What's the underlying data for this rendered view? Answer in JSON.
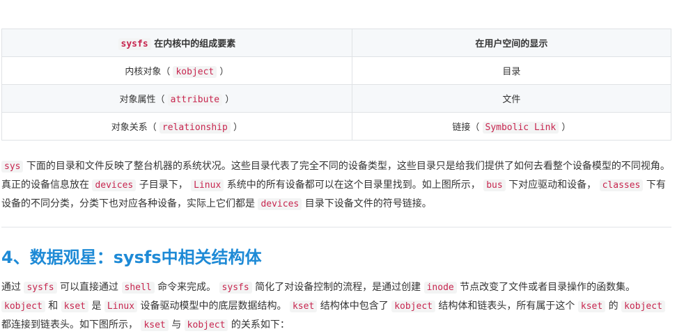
{
  "table": {
    "header": {
      "col1_code": "sysfs",
      "col1_text": " 在内核中的组成要素",
      "col2": "在用户空间的显示"
    },
    "rows": [
      {
        "pre": "内核对象（ ",
        "code": "kobject",
        "post": " ）",
        "value": "目录"
      },
      {
        "pre": "对象属性（ ",
        "code": "attribute",
        "post": " ）",
        "value": "文件"
      },
      {
        "pre": "对象关系（ ",
        "code": "relationship",
        "post": " ）",
        "value_pre": "链接（ ",
        "value_code": "Symbolic Link",
        "value_post": " ）"
      }
    ]
  },
  "para1": {
    "t1": "sys",
    "t2": " 下面的目录和文件反映了整台机器的系统状况。这些目录代表了完全不同的设备类型，这些目录只是给我们提供了如何去看整个设备模型的不同视角。真正的设备信息放在 ",
    "t3": "devices",
    "t4": " 子目录下， ",
    "t5": "Linux",
    "t6": " 系统中的所有设备都可以在这个目录里找到。如上图所示， ",
    "t7": "bus",
    "t8": " 下对应驱动和设备， ",
    "t9": "classes",
    "t10": " 下有设备的不同分类，分类下也对应各种设备，实际上它们都是 ",
    "t11": "devices",
    "t12": " 目录下设备文件的符号链接。"
  },
  "heading": "4、数据观星：sysfs中相关结构体",
  "para2": {
    "t1": "通过 ",
    "t2": "sysfs",
    "t3": " 可以直接通过 ",
    "t4": "shell",
    "t5": " 命令来完成。 ",
    "t6": "sysfs",
    "t7": " 简化了对设备控制的流程，是通过创建 ",
    "t8": "inode",
    "t9": " 节点改变了文件或者目录操作的函数集。 ",
    "t10": "kobject",
    "t11": " 和 ",
    "t12": "kset",
    "t13": " 是 ",
    "t14": "Linux",
    "t15": " 设备驱动模型中的底层数据结构。 ",
    "t16": "kset",
    "t17": " 结构体中包含了 ",
    "t18": "kobject",
    "t19": " 结构体和链表头，所有属于这个 ",
    "t20": "kset",
    "t21": " 的 ",
    "t22": "kobject",
    "t23": " 都连接到链表头。如下图所示， ",
    "t24": "kset",
    "t25": " 与 ",
    "t26": "kobject",
    "t27": " 的关系如下："
  }
}
